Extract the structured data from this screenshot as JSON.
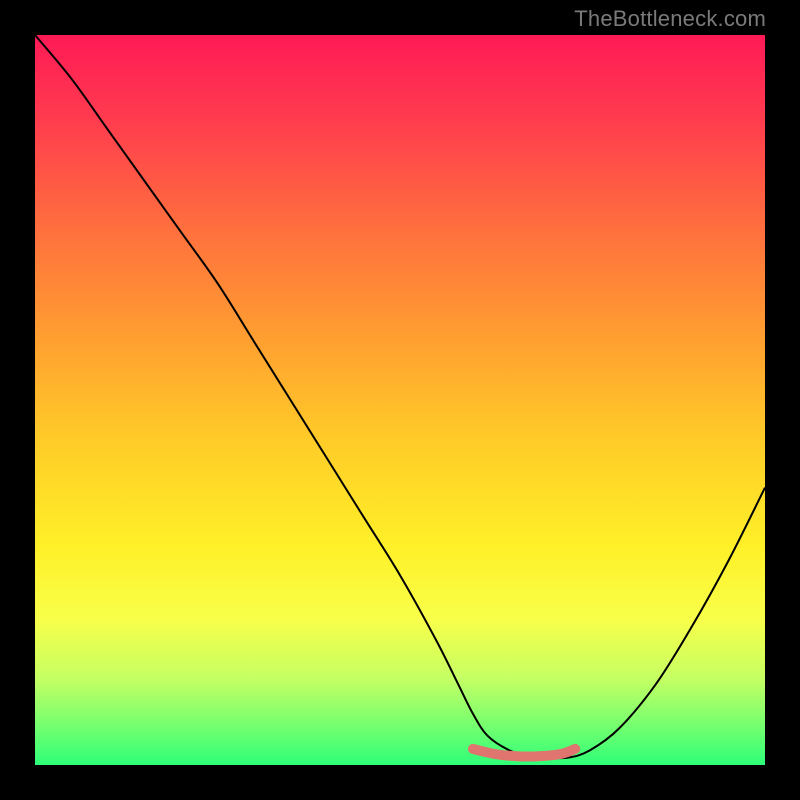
{
  "watermark": "TheBottleneck.com",
  "chart_data": {
    "type": "line",
    "title": "",
    "xlabel": "",
    "ylabel": "",
    "xlim": [
      0,
      100
    ],
    "ylim": [
      0,
      100
    ],
    "grid": false,
    "legend": false,
    "note": "Axes are unlabeled; x/y values are positional estimates read from the image (percent of plot width/height, y measured from bottom).",
    "series": [
      {
        "name": "black-curve",
        "color": "#000000",
        "stroke_width": 2,
        "x": [
          0,
          5,
          10,
          15,
          20,
          25,
          30,
          35,
          40,
          45,
          50,
          55,
          58,
          60,
          62,
          65,
          68,
          70,
          73,
          76,
          80,
          85,
          90,
          95,
          100
        ],
        "y": [
          100,
          94,
          87,
          80,
          73,
          66,
          58,
          50,
          42,
          34,
          26,
          17,
          11,
          7,
          4,
          2,
          1,
          1,
          1,
          2,
          5,
          11,
          19,
          28,
          38
        ]
      },
      {
        "name": "red-segment",
        "color": "#e0746e",
        "stroke_width": 10,
        "x": [
          60,
          63,
          66,
          69,
          72,
          74
        ],
        "y": [
          2.2,
          1.5,
          1.2,
          1.2,
          1.5,
          2.2
        ]
      }
    ]
  }
}
